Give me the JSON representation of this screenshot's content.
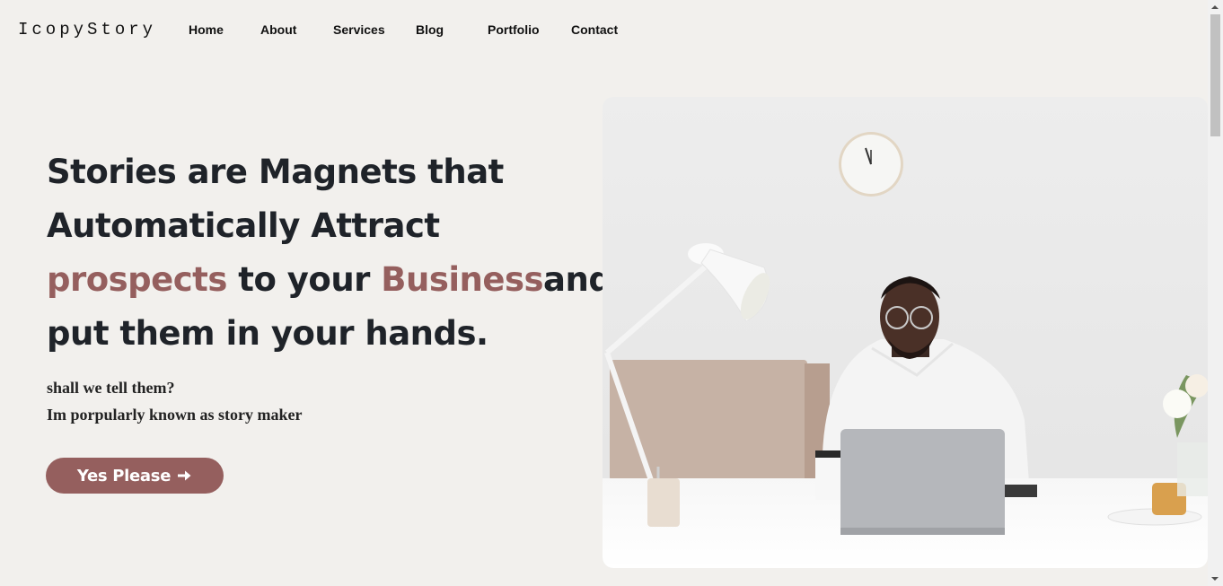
{
  "brand": {
    "logo": "IcopyStory"
  },
  "nav": {
    "items": [
      {
        "label": "Home"
      },
      {
        "label": "About"
      },
      {
        "label": "Services"
      },
      {
        "label": "Blog"
      },
      {
        "label": "Portfolio"
      },
      {
        "label": "Contact"
      }
    ]
  },
  "hero": {
    "title_part1": "Stories are Magnets that Automatically Attract ",
    "title_accent1": "prospects",
    "title_part2": " to your ",
    "title_accent2": "Business",
    "title_part3": "and put them in your hands.",
    "subtitle1": "shall we tell them?",
    "subtitle2": "Im porpularly known as story maker",
    "cta_label": "Yes Please",
    "cta_icon": "arrow-right-icon",
    "image_icon": "man-at-laptop-photo"
  },
  "colors": {
    "background": "#f2f0ed",
    "accent": "#955f5e",
    "text": "#1f2329"
  }
}
